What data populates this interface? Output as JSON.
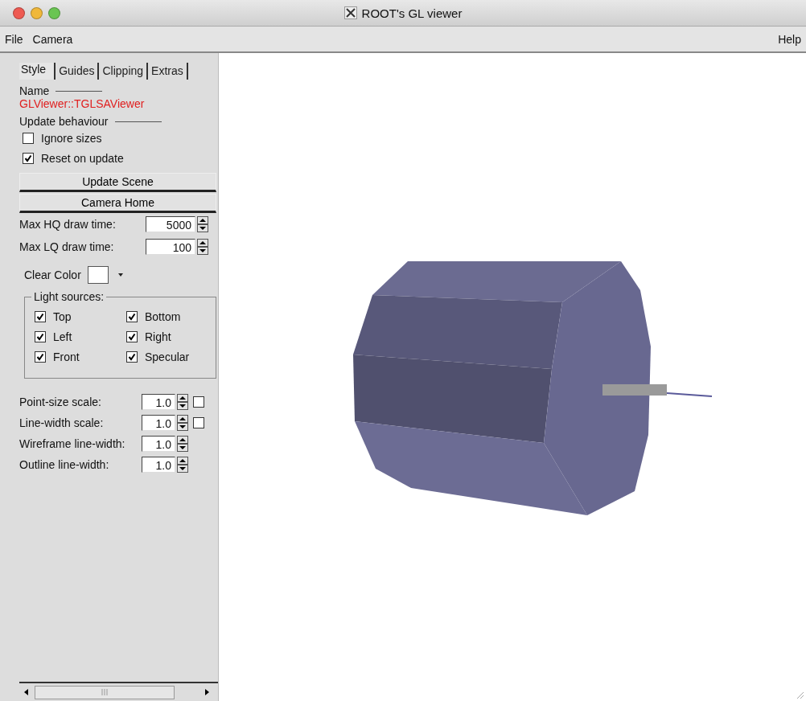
{
  "window": {
    "title": "ROOT's GL viewer"
  },
  "menu": {
    "items": [
      "File",
      "Camera"
    ],
    "help": "Help"
  },
  "tabs": [
    {
      "label": "Style",
      "selected": true
    },
    {
      "label": "Guides",
      "selected": false
    },
    {
      "label": "Clipping",
      "selected": false
    },
    {
      "label": "Extras",
      "selected": false
    }
  ],
  "name_section": {
    "label": "Name",
    "value": "GLViewer::TGLSAViewer"
  },
  "update_behaviour": {
    "label": "Update behaviour",
    "options": [
      {
        "label": "Ignore sizes",
        "checked": false
      },
      {
        "label": "Reset on update",
        "checked": true
      }
    ]
  },
  "buttons": [
    "Update Scene",
    "Camera Home"
  ],
  "draw_times": [
    {
      "label": "Max HQ draw time:",
      "value": "5000"
    },
    {
      "label": "Max LQ draw time:",
      "value": "100"
    }
  ],
  "clear_color": {
    "label": "Clear Color"
  },
  "light_sources": {
    "title": "Light sources:",
    "items": [
      {
        "label": "Top",
        "checked": true
      },
      {
        "label": "Bottom",
        "checked": true
      },
      {
        "label": "Left",
        "checked": true
      },
      {
        "label": "Right",
        "checked": true
      },
      {
        "label": "Front",
        "checked": true
      },
      {
        "label": "Specular",
        "checked": true
      }
    ]
  },
  "scales": [
    {
      "kind": "spin_check",
      "label": "Point-size scale:",
      "value": "1.0",
      "checked": false
    },
    {
      "kind": "spin_check",
      "label": "Line-width scale:",
      "value": "1.0",
      "checked": false
    },
    {
      "kind": "spin",
      "label": "Wireframe line-width:",
      "value": "1.0"
    },
    {
      "kind": "spin",
      "label": "Outline line-width:",
      "value": "1.0"
    }
  ]
}
